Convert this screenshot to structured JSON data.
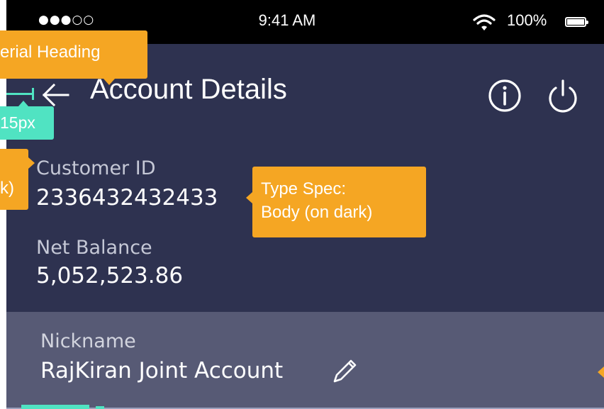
{
  "status_bar": {
    "signal": "●●●○○",
    "time": "9:41 AM",
    "battery": "100%"
  },
  "header": {
    "title": "Account Details"
  },
  "fields": {
    "customer_id_label": "Customer ID",
    "customer_id_value": "2336432432433",
    "net_balance_label": "Net Balance",
    "net_balance_value": "5,052,523.86"
  },
  "nickname": {
    "label": "Nickname",
    "value": "RajKiran Joint Account"
  },
  "annotations": {
    "heading": "erial Heading",
    "spacing": "15px",
    "left_clip": "k)",
    "type_spec_line1": "Type Spec:",
    "type_spec_line2": "Body (on dark)"
  },
  "colors": {
    "background": "#2e3250",
    "nickname_section": "#575a75",
    "annotation_orange": "#f5a623",
    "annotation_teal": "#50e3c2"
  }
}
